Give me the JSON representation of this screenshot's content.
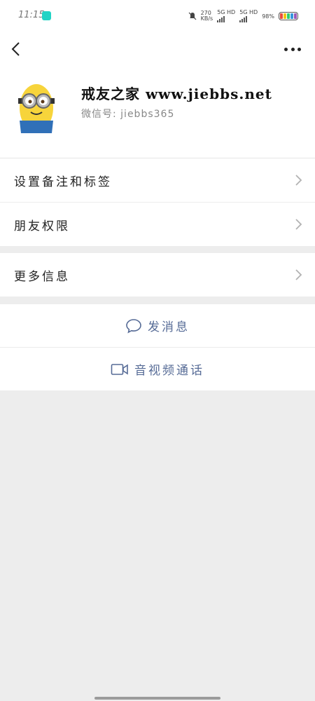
{
  "status_bar": {
    "time": "11:15",
    "net_speed_top": "270",
    "net_speed_bottom": "KB/s",
    "sim1": "5G HD",
    "sim2": "5G HD",
    "battery": "98%"
  },
  "profile": {
    "name": "戒友之家 www.jiebbs.net",
    "wechat_id": "微信号: jiebbs365"
  },
  "menu": {
    "remark_tags": "设置备注和标签",
    "friend_permissions": "朋友权限",
    "more_info": "更多信息"
  },
  "actions": {
    "send_message": "发消息",
    "av_call": "音视频通话"
  },
  "colors": {
    "link_blue": "#566b96",
    "background": "#ededed"
  }
}
